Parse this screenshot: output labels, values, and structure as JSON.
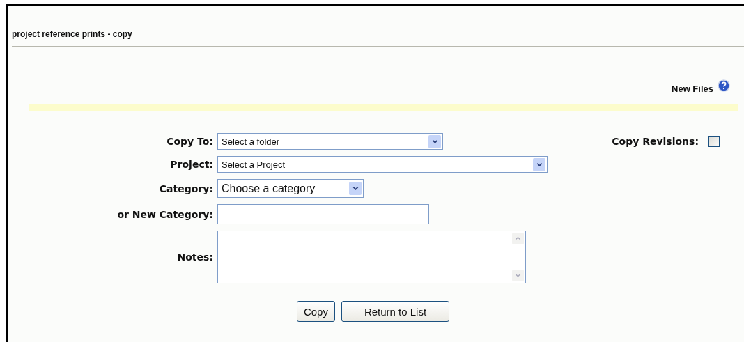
{
  "page": {
    "title": "project reference prints - copy"
  },
  "section": {
    "label": "New Files"
  },
  "form": {
    "fields": [
      {
        "kind": "select",
        "label": "Copy To:",
        "value": "Select a folder"
      },
      {
        "kind": "select",
        "label": "Project:",
        "value": "Select a Project"
      },
      {
        "kind": "select",
        "label": "Category:",
        "value": "Choose a category"
      },
      {
        "kind": "text",
        "label": "or New Category:"
      },
      {
        "kind": "textarea",
        "label": "Notes:"
      }
    ],
    "copy_revisions": {
      "label": "Copy Revisions:",
      "checked": false
    }
  },
  "buttons": [
    "Copy",
    "Return to List"
  ]
}
